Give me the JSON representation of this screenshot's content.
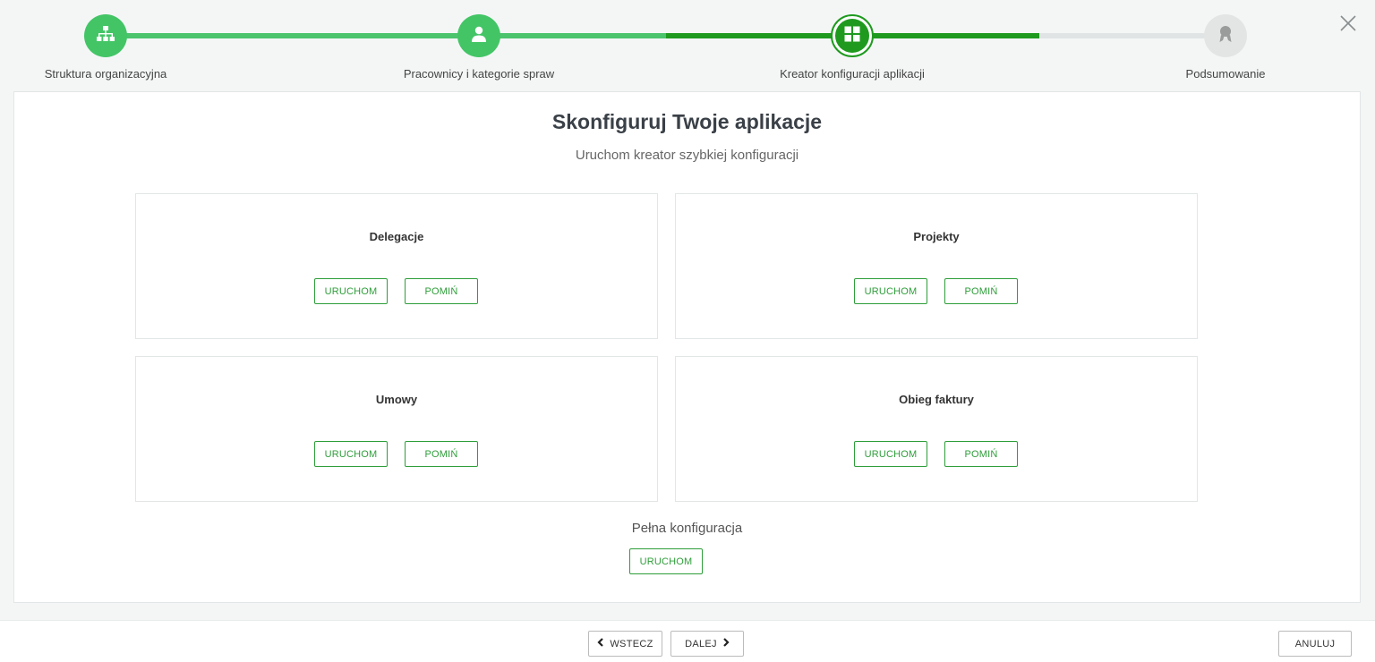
{
  "stepper": {
    "steps": [
      {
        "label": "Struktura organizacyjna",
        "state": "done",
        "icon": "sitemap-icon"
      },
      {
        "label": "Pracownicy i kategorie spraw",
        "state": "done",
        "icon": "user-icon"
      },
      {
        "label": "Kreator konfiguracji aplikacji",
        "state": "active",
        "icon": "apps-grid-icon"
      },
      {
        "label": "Podsumowanie",
        "state": "todo",
        "icon": "award-icon"
      }
    ],
    "colors": {
      "done": "#43c566",
      "active": "#1f9a1f",
      "todo": "#e3e5e5"
    }
  },
  "main": {
    "title": "Skonfiguruj Twoje aplikacje",
    "subtitle": "Uruchom kreator szybkiej konfiguracji",
    "cards": [
      {
        "title": "Delegacje",
        "run_label": "URUCHOM",
        "skip_label": "POMIŃ"
      },
      {
        "title": "Projekty",
        "run_label": "URUCHOM",
        "skip_label": "POMIŃ"
      },
      {
        "title": "Umowy",
        "run_label": "URUCHOM",
        "skip_label": "POMIŃ"
      },
      {
        "title": "Obieg faktury",
        "run_label": "URUCHOM",
        "skip_label": "POMIŃ"
      }
    ],
    "full_config": {
      "title": "Pełna konfiguracja",
      "run_label": "URUCHOM"
    }
  },
  "footer": {
    "back_label": "WSTECZ",
    "next_label": "DALEJ",
    "cancel_label": "ANULUJ"
  },
  "accent_color": "#2e9e3a"
}
